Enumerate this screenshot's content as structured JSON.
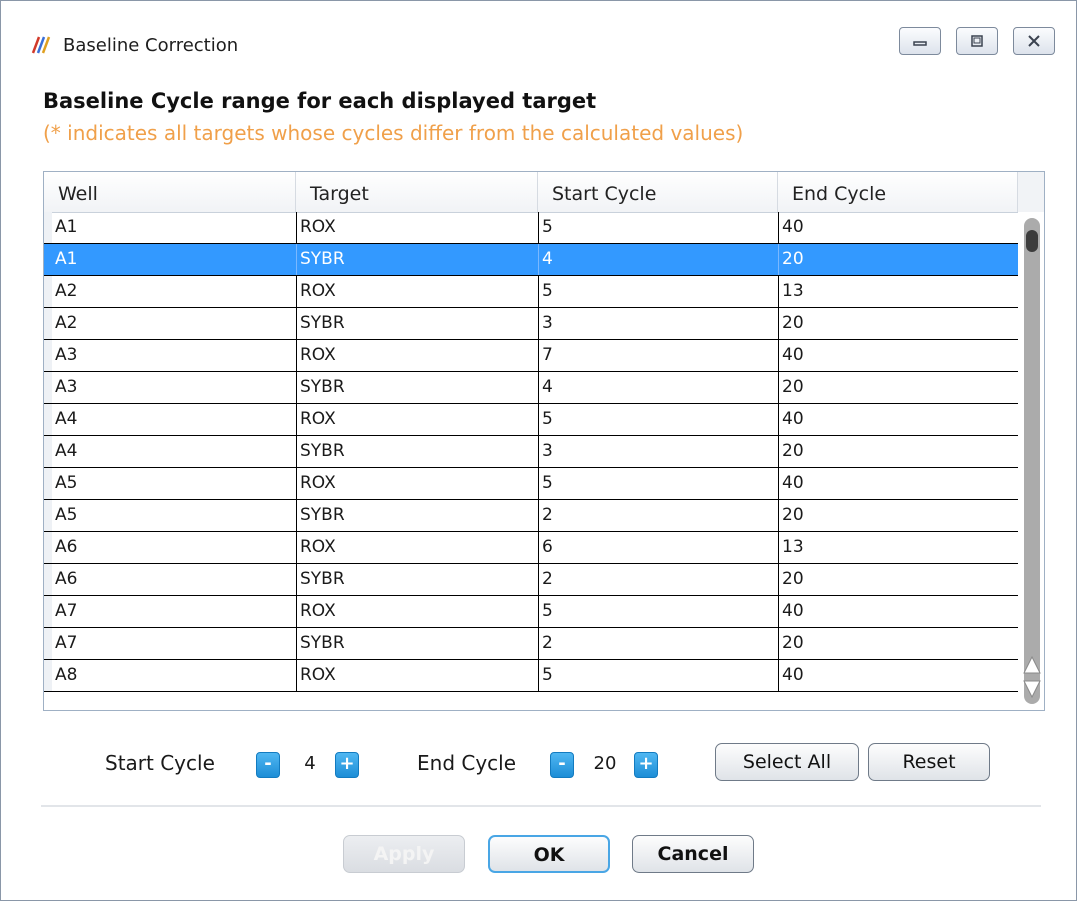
{
  "window": {
    "title": "Baseline Correction",
    "icon": "app-logo-icon",
    "controls": [
      "minimize-icon",
      "maximize-icon",
      "close-icon"
    ]
  },
  "header": {
    "title": "Baseline Cycle range for each displayed target",
    "note": "(* indicates all targets whose cycles differ from the calculated values)",
    "note_color": "#f0a04a"
  },
  "table": {
    "columns": [
      "Well",
      "Target",
      "Start Cycle",
      "End Cycle"
    ],
    "rows": [
      {
        "well": "A1",
        "target": "ROX",
        "start": "5",
        "end": "40"
      },
      {
        "well": "A1",
        "target": "SYBR",
        "start": "4",
        "end": "20"
      },
      {
        "well": "A2",
        "target": "ROX",
        "start": "5",
        "end": "13"
      },
      {
        "well": "A2",
        "target": "SYBR",
        "start": "3",
        "end": "20"
      },
      {
        "well": "A3",
        "target": "ROX",
        "start": "7",
        "end": "40"
      },
      {
        "well": "A3",
        "target": "SYBR",
        "start": "4",
        "end": "20"
      },
      {
        "well": "A4",
        "target": "ROX",
        "start": "5",
        "end": "40"
      },
      {
        "well": "A4",
        "target": "SYBR",
        "start": "3",
        "end": "20"
      },
      {
        "well": "A5",
        "target": "ROX",
        "start": "5",
        "end": "40"
      },
      {
        "well": "A5",
        "target": "SYBR",
        "start": "2",
        "end": "20"
      },
      {
        "well": "A6",
        "target": "ROX",
        "start": "6",
        "end": "13"
      },
      {
        "well": "A6",
        "target": "SYBR",
        "start": "2",
        "end": "20"
      },
      {
        "well": "A7",
        "target": "ROX",
        "start": "5",
        "end": "40"
      },
      {
        "well": "A7",
        "target": "SYBR",
        "start": "2",
        "end": "20"
      },
      {
        "well": "A8",
        "target": "ROX",
        "start": "5",
        "end": "40"
      }
    ],
    "selected_row": 1,
    "selection_color": "#3399ff"
  },
  "controls": {
    "start_label": "Start Cycle",
    "start_value": "4",
    "end_label": "End Cycle",
    "end_value": "20",
    "minus": "-",
    "plus": "+",
    "select_all": "Select All",
    "reset": "Reset"
  },
  "footer": {
    "apply": "Apply",
    "ok": "OK",
    "cancel": "Cancel"
  },
  "accent_color": "#1d8dd6"
}
